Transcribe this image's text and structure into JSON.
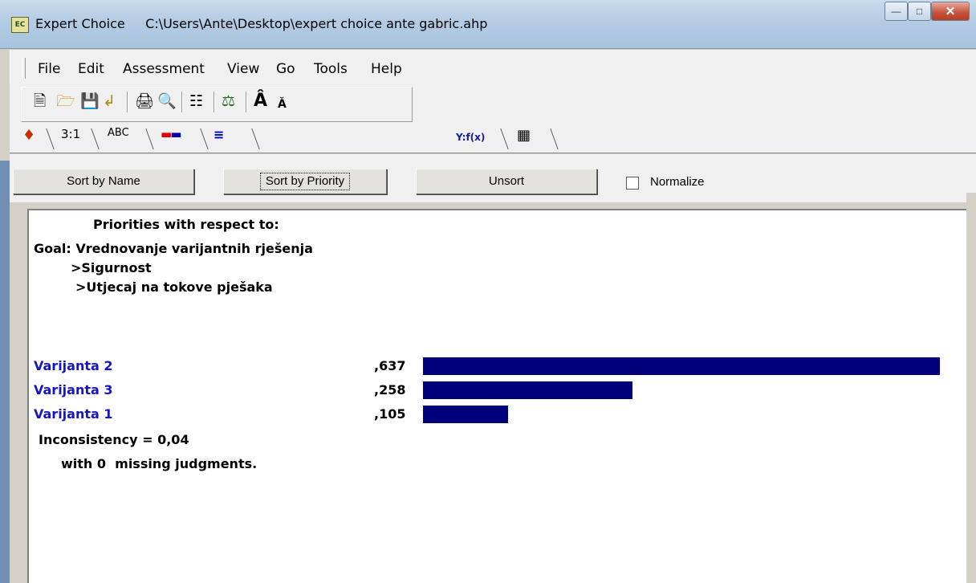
{
  "window": {
    "app_name": "Expert Choice",
    "file_path": "C:\\Users\\Ante\\Desktop\\expert choice ante gabric.ahp"
  },
  "menu": [
    "File",
    "Edit",
    "Assessment",
    "View",
    "Go",
    "Tools",
    "Help"
  ],
  "tabs": {
    "ratio_label": "3:1",
    "abc_label": "ABC",
    "formula_label": "Y:f(x)"
  },
  "sort": {
    "by_name": "Sort by Name",
    "by_priority": "Sort by Priority",
    "unsort": "Unsort",
    "normalize": "Normalize",
    "normalize_checked": false
  },
  "report": {
    "heading": "Priorities with respect to:",
    "goal": "Goal: Vrednovanje varijantnih rješenja",
    "level1": ">Sigurnost",
    "level2": ">Utjecaj na tokove pješaka",
    "alternatives": [
      {
        "name": "Varijanta 2",
        "value_label": ",637",
        "value": 0.637
      },
      {
        "name": "Varijanta 3",
        "value_label": ",258",
        "value": 0.258
      },
      {
        "name": "Varijanta 1",
        "value_label": ",105",
        "value": 0.105
      }
    ],
    "inconsistency": "Inconsistency = 0,04",
    "missing": "with 0  missing judgments."
  },
  "colors": {
    "bar": "#00007a",
    "alt_name": "#1414c8"
  }
}
